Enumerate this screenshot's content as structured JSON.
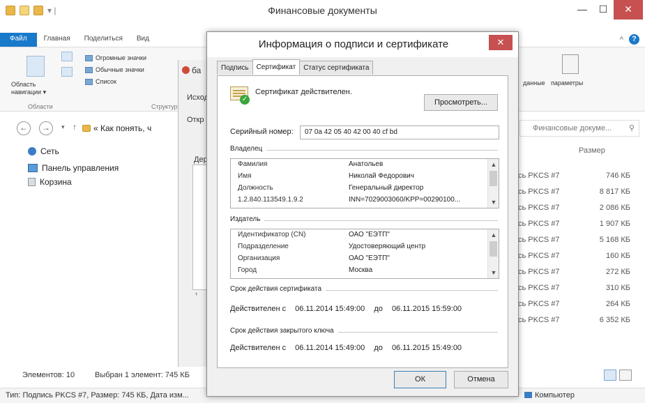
{
  "explorer": {
    "title": "Финансовые документы",
    "ribbon_tabs": [
      "Файл",
      "Главная",
      "Поделиться",
      "Вид"
    ],
    "ribbon": {
      "nav_pane_label": "Область навигации ▾",
      "nav_group_label": "Области",
      "layout_items": [
        "Огромные значки",
        "Обычные значки",
        "Список"
      ],
      "layout_group_label": "Структура",
      "right_items": [
        "данные",
        "параметры"
      ]
    },
    "path": "« Как понять, ч",
    "search_placeholder": "Финансовые докуме...",
    "nav_items": [
      "Сеть",
      "Панель управления",
      "Корзина"
    ],
    "size_header": "Размер",
    "files": [
      {
        "type": "сь PKCS #7",
        "size": "746 КБ"
      },
      {
        "type": "сь PKCS #7",
        "size": "8 817 КБ"
      },
      {
        "type": "сь PKCS #7",
        "size": "2 086 КБ"
      },
      {
        "type": "сь PKCS #7",
        "size": "1 907 КБ"
      },
      {
        "type": "сь PKCS #7",
        "size": "5 168 КБ"
      },
      {
        "type": "сь PKCS #7",
        "size": "160 КБ"
      },
      {
        "type": "сь PKCS #7",
        "size": "272 КБ"
      },
      {
        "type": "сь PKCS #7",
        "size": "310 КБ"
      },
      {
        "type": "сь PKCS #7",
        "size": "264 КБ"
      },
      {
        "type": "сь PKCS #7",
        "size": "6 352 КБ"
      }
    ],
    "status": {
      "count": "Элементов: 10",
      "selected": "Выбран 1 элемент: 745 КБ"
    },
    "bottom": {
      "info": "Тип: Подпись PKCS #7, Размер: 745 КБ, Дата изм...",
      "computer": "Компьютер"
    }
  },
  "middle_window": {
    "title": "ба",
    "lines": [
      "Исход",
      "Откр",
      "Дер"
    ]
  },
  "dialog": {
    "title": "Информация о подписи и сертификате",
    "close_glyph": "✕",
    "tabs": [
      "Подпись",
      "Сертификат",
      "Статус сертификата"
    ],
    "active_tab": "Сертификат",
    "cert_status": "Сертификат действителен.",
    "view_button": "Просмотреть...",
    "serial_label": "Серийный номер:",
    "serial_value": "07 0a 42 05 40 42 00 40 cf bd",
    "owner_section": "Владелец",
    "owner": [
      {
        "k": "Фамилия",
        "v": "Анатольев"
      },
      {
        "k": "Имя",
        "v": "Николай Федорович"
      },
      {
        "k": "Должность",
        "v": "Генеральный директор"
      },
      {
        "k": "1.2.840.113549.1.9.2",
        "v": "INN=7029003060/KPP=00290100..."
      }
    ],
    "issuer_section": "Издатель",
    "issuer": [
      {
        "k": "Идентификатор (CN)",
        "v": "ОАО \"ЕЭТП\""
      },
      {
        "k": "Подразделение",
        "v": "Удостоверяющий центр"
      },
      {
        "k": "Организация",
        "v": "ОАО \"ЕЭТП\""
      },
      {
        "k": "Город",
        "v": "Москва"
      }
    ],
    "cert_validity_section": "Срок действия сертификата",
    "cert_validity": {
      "from_label": "Действителен с",
      "from": "06.11.2014 15:49:00",
      "to_label": "до",
      "to": "06.11.2015 15:59:00"
    },
    "key_validity_section": "Срок действия закрытого ключа",
    "key_validity": {
      "from_label": "Действителен с",
      "from": "06.11.2014 15:49:00",
      "to_label": "до",
      "to": "06.11.2015 15:49:00"
    },
    "ok_button": "ОК",
    "cancel_button": "Отмена"
  }
}
